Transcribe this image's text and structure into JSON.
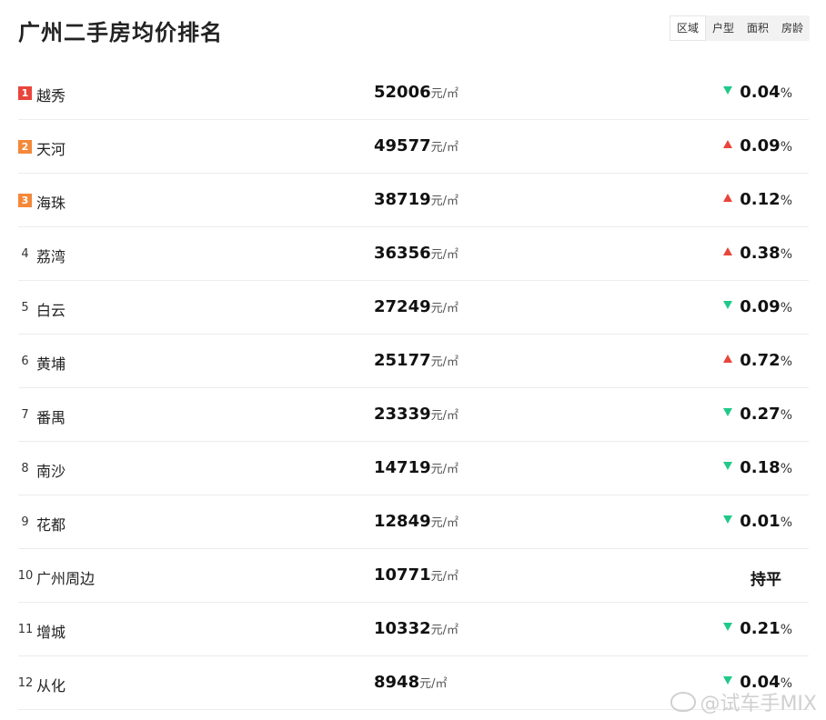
{
  "title": "广州二手房均价排名",
  "tabs": [
    "区域",
    "户型",
    "面积",
    "房龄"
  ],
  "active_tab": "区域",
  "unit": "元/㎡",
  "pct_sign": "%",
  "flat_label": "持平",
  "colors": {
    "up": "#e8453c",
    "down": "#20c98a",
    "rank1": "#e8453c",
    "rank2": "#f4883a",
    "rank3": "#f4883a"
  },
  "rows": [
    {
      "rank": "1",
      "name": "越秀",
      "price": "52006",
      "dir": "down",
      "change": "0.04"
    },
    {
      "rank": "2",
      "name": "天河",
      "price": "49577",
      "dir": "up",
      "change": "0.09"
    },
    {
      "rank": "3",
      "name": "海珠",
      "price": "38719",
      "dir": "up",
      "change": "0.12"
    },
    {
      "rank": "4",
      "name": "荔湾",
      "price": "36356",
      "dir": "up",
      "change": "0.38"
    },
    {
      "rank": "5",
      "name": "白云",
      "price": "27249",
      "dir": "down",
      "change": "0.09"
    },
    {
      "rank": "6",
      "name": "黄埔",
      "price": "25177",
      "dir": "up",
      "change": "0.72"
    },
    {
      "rank": "7",
      "name": "番禺",
      "price": "23339",
      "dir": "down",
      "change": "0.27"
    },
    {
      "rank": "8",
      "name": "南沙",
      "price": "14719",
      "dir": "down",
      "change": "0.18"
    },
    {
      "rank": "9",
      "name": "花都",
      "price": "12849",
      "dir": "down",
      "change": "0.01"
    },
    {
      "rank": "10",
      "name": "广州周边",
      "price": "10771",
      "dir": "flat",
      "change": ""
    },
    {
      "rank": "11",
      "name": "增城",
      "price": "10332",
      "dir": "down",
      "change": "0.21"
    },
    {
      "rank": "12",
      "name": "从化",
      "price": "8948",
      "dir": "down",
      "change": "0.04"
    }
  ],
  "watermark": "@试车手MIX"
}
